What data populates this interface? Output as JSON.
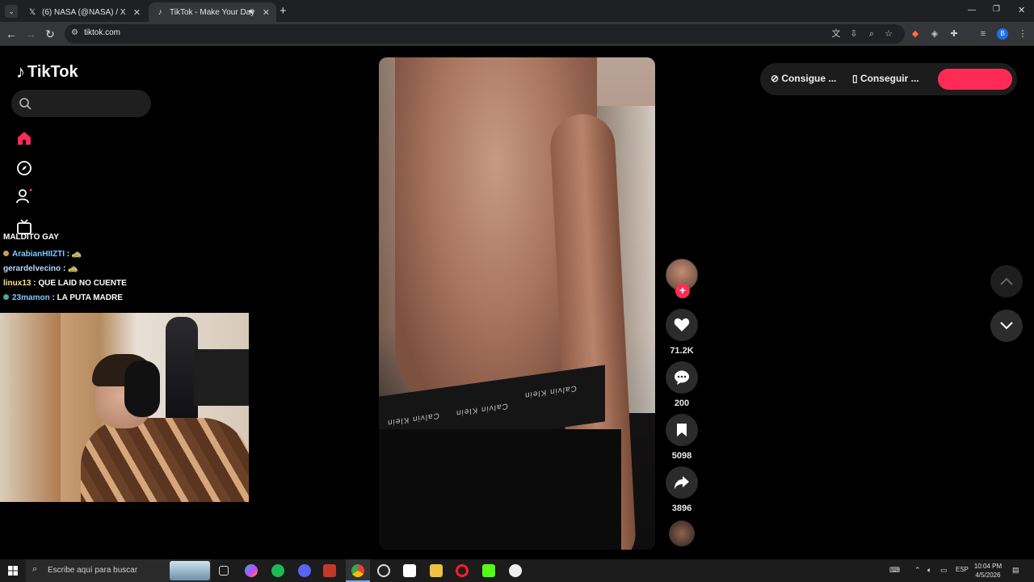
{
  "browser": {
    "tabs": [
      {
        "title": "(6) NASA (@NASA) / X",
        "favicon": "x-logo-icon",
        "active": false
      },
      {
        "title": "TikTok - Make Your Day",
        "favicon": "tiktok-icon",
        "active": true
      }
    ],
    "url": "tiktok.com"
  },
  "tiktok": {
    "logo_text": "TikTok",
    "search_placeholder": "",
    "topbar": {
      "get_coins_label": "Consigue ...",
      "get_app_label": "Conseguir ...",
      "login_label": ""
    },
    "actions": {
      "likes": "71.2K",
      "comments": "200",
      "saves": "5098",
      "shares": "3896"
    },
    "video_text": [
      "Calvin Klein",
      "Calvin Klein",
      "Calvin Klein"
    ]
  },
  "stream_overlay": {
    "chat_title": "MALDITO GAY",
    "messages": [
      {
        "user": "ArabianHIIZTI",
        "text": ":",
        "color": "#7ec8ff"
      },
      {
        "user": "gerardelvecino",
        "text": ":",
        "color": "#b8d8ff"
      },
      {
        "user": "linux13",
        "text": ": QUE LAID NO CUENTE",
        "color": "#ffe08a"
      },
      {
        "user": "23mamon",
        "text": ": LA PUTA MADRE",
        "color": "#7ec8ff"
      }
    ]
  },
  "taskbar": {
    "search_placeholder": "Escribe aquí para buscar",
    "lang": "ESP",
    "time": "10:04 PM",
    "date": "4/5/2026"
  },
  "colors": {
    "accent": "#fe2c55",
    "background": "#000000",
    "chrome": "#35363a"
  }
}
